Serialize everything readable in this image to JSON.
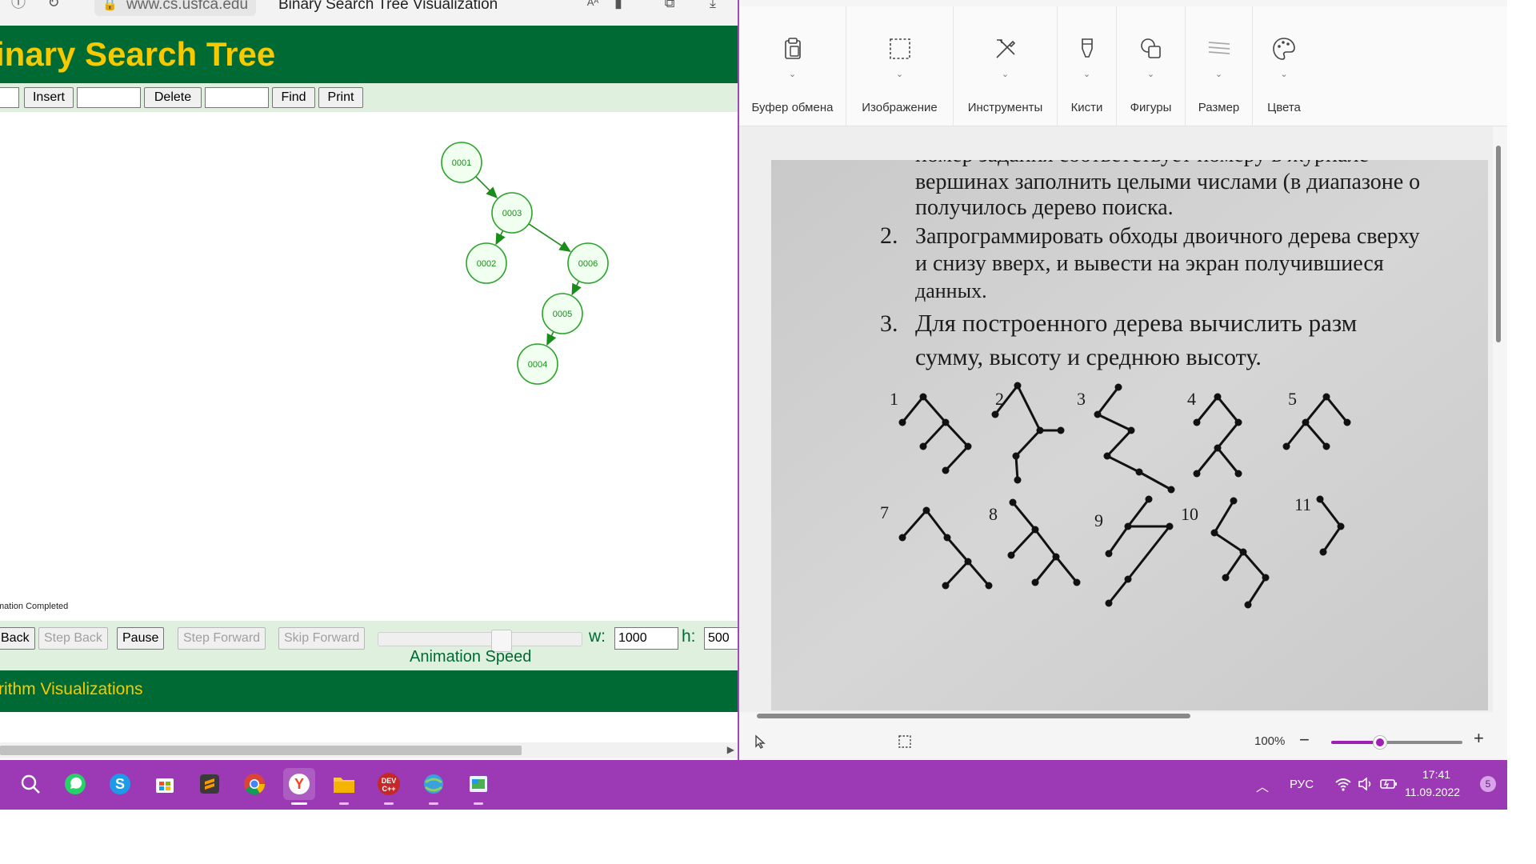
{
  "browser": {
    "url": "www.cs.usfca.edu",
    "tab_title": "Binary Search Tree Visualization",
    "header_title": "inary Search Tree",
    "controls": {
      "insert_label": "Insert",
      "insert_value": "",
      "delete_label": "Delete",
      "delete_value": "",
      "find_label": "Find",
      "print_label": "Print"
    },
    "tree": {
      "nodes": [
        "0001",
        "0003",
        "0002",
        "0006",
        "0005",
        "0004"
      ]
    },
    "status": "mation Completed",
    "anim": {
      "back_label": "Back",
      "step_back_label": "Step Back",
      "pause_label": "Pause",
      "step_forward_label": "Step Forward",
      "skip_forward_label": "Skip Forward",
      "speed_label": "Animation Speed",
      "speed_fraction": 0.6,
      "w_label": "w:",
      "w_value": "1000",
      "h_label": "h:",
      "h_value": "500"
    },
    "footer": "rithm Visualizations"
  },
  "paint": {
    "ribbon": [
      {
        "label": "Буфер обмена",
        "icon": "clipboard-icon"
      },
      {
        "label": "Изображение",
        "icon": "selection-icon"
      },
      {
        "label": "Инструменты",
        "icon": "tools-icon"
      },
      {
        "label": "Кисти",
        "icon": "brush-icon"
      },
      {
        "label": "Фигуры",
        "icon": "shapes-icon"
      },
      {
        "label": "Размер",
        "icon": "size-icon"
      },
      {
        "label": "Цвета",
        "icon": "palette-icon"
      }
    ],
    "photo_text": {
      "line0": "номер задания соответствует номеру в журнале",
      "line1": "вершинах заполнить целыми числами (в диапазоне о",
      "line2": "получилось дерево поиска.",
      "item2_num": "2.",
      "line3": "Запрограммировать обходы двоичного дерева сверху",
      "line4": "и  снизу  вверх,  и  вывести  на  экран  получившиеся",
      "line5": "данных.",
      "item3_num": "3.",
      "line6": "Для   построенного   дерева   вычислить   разм",
      "line7": "сумму, высоту и среднюю высоту.",
      "tree_numbers": [
        "1",
        "2",
        "3",
        "4",
        "5",
        "7",
        "8",
        "9",
        "10",
        "11"
      ]
    },
    "zoom": "100%",
    "zoom_fraction": 0.37
  },
  "taskbar": {
    "apps": [
      "search-icon",
      "whatsapp-icon",
      "skype-icon",
      "store-icon",
      "sublime-icon",
      "chrome-icon",
      "yandex-browser-icon",
      "file-explorer-icon",
      "devcpp-icon",
      "network-app-icon",
      "paint-app-icon"
    ],
    "lang": "РУС",
    "time": "17:41",
    "date": "11.09.2022",
    "notification_count": "5"
  },
  "colors": {
    "usf_green": "#006a34",
    "usf_gold": "#f6c900",
    "node_green": "#29a329",
    "taskbar": "#9b3ab4",
    "accent": "#a01fb8"
  }
}
